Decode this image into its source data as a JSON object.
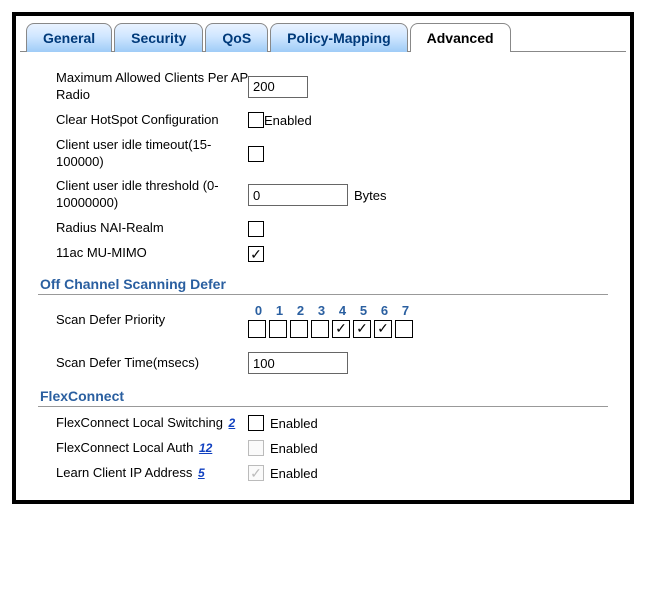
{
  "tabs": {
    "general": "General",
    "security": "Security",
    "qos": "QoS",
    "policy": "Policy-Mapping",
    "advanced": "Advanced"
  },
  "fields": {
    "maxClientsLabel": "Maximum Allowed Clients Per AP Radio",
    "maxClientsValue": "200",
    "clearHotspotLabel": "Clear HotSpot Configuration",
    "enabledText": "Enabled",
    "clientIdleTimeoutLabel": "Client user idle timeout(15-100000)",
    "clientIdleThresholdLabel": "Client user idle threshold (0-10000000)",
    "clientIdleThresholdValue": "0",
    "bytesText": "Bytes",
    "radiusNaiLabel": "Radius NAI-Realm",
    "muMimoLabel": "11ac MU-MIMO"
  },
  "off": {
    "sectionTitle": "Off Channel Scanning Defer",
    "scanDeferPriorityLabel": "Scan Defer Priority",
    "priorities": [
      "0",
      "1",
      "2",
      "3",
      "4",
      "5",
      "6",
      "7"
    ],
    "priorityChecked": [
      false,
      false,
      false,
      false,
      true,
      true,
      true,
      false
    ],
    "scanDeferTimeLabel": "Scan Defer Time(msecs)",
    "scanDeferTimeValue": "100"
  },
  "flex": {
    "sectionTitle": "FlexConnect",
    "localSwitchingLabel": "FlexConnect Local Switching",
    "localSwitchingNote": "2",
    "localAuthLabel": "FlexConnect Local Auth",
    "localAuthNote": "12",
    "learnIpLabel": "Learn Client IP Address",
    "learnIpNote": "5",
    "enabledText": "Enabled"
  }
}
